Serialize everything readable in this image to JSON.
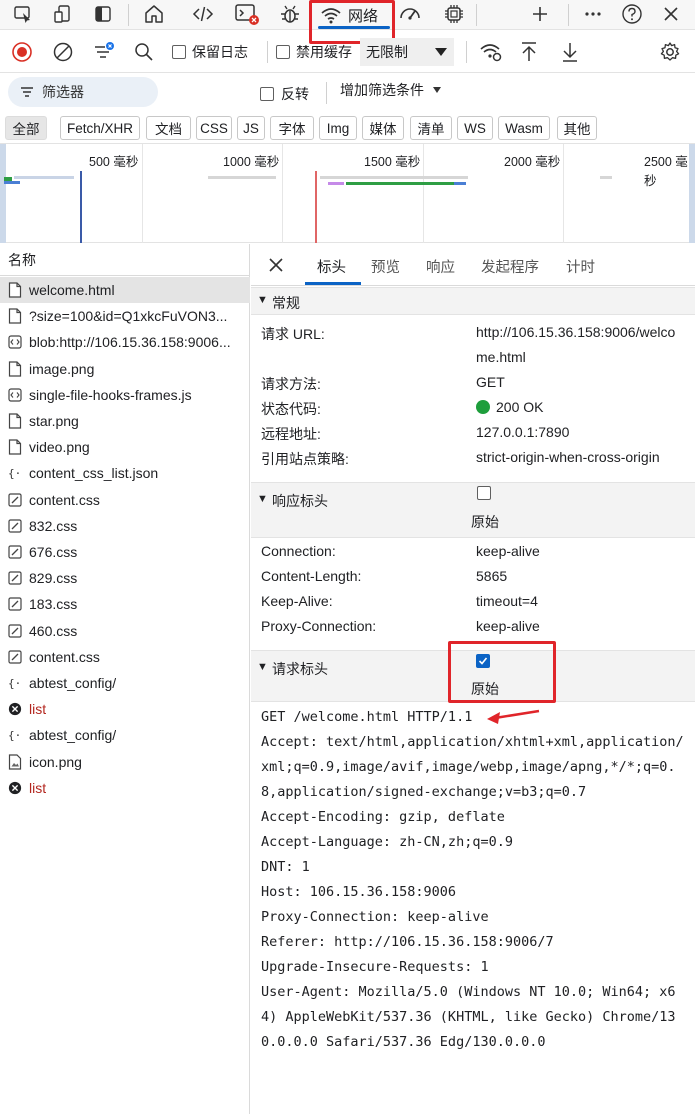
{
  "top_tabs": {
    "network_label": "网络",
    "icons": [
      "inspect-icon",
      "device-icon",
      "sidebar-toggle-icon",
      "home-icon",
      "elements-icon",
      "console-icon",
      "debug-icon",
      "network-icon",
      "performance-icon",
      "memory-icon",
      "add-icon",
      "more-icon",
      "help-icon",
      "close-icon"
    ]
  },
  "toolbar": {
    "preserve_log": "保留日志",
    "disable_cache": "禁用缓存",
    "throttle": "无限制"
  },
  "filter": {
    "placeholder": "筛选器",
    "invert": "反转",
    "add_filter": "增加筛选条件"
  },
  "types": [
    "全部",
    "Fetch/XHR",
    "文档",
    "CSS",
    "JS",
    "字体",
    "Img",
    "媒体",
    "清单",
    "WS",
    "Wasm",
    "其他"
  ],
  "overview": {
    "ticks": [
      "500 毫秒",
      "1000 毫秒",
      "1500 毫秒",
      "2000 毫秒",
      "2500 毫秒"
    ]
  },
  "list": {
    "header": "名称",
    "rows": [
      {
        "name": "welcome.html",
        "kind": "doc",
        "error": false,
        "selected": true
      },
      {
        "name": "?size=100&id=Q1xkcFuVON3...",
        "kind": "doc",
        "error": false
      },
      {
        "name": "blob:http://106.15.36.158:9006...",
        "kind": "script",
        "error": false
      },
      {
        "name": "image.png",
        "kind": "doc",
        "error": false
      },
      {
        "name": "single-file-hooks-frames.js",
        "kind": "script",
        "error": false
      },
      {
        "name": "star.png",
        "kind": "doc",
        "error": false
      },
      {
        "name": "video.png",
        "kind": "doc",
        "error": false
      },
      {
        "name": "content_css_list.json",
        "kind": "json",
        "error": false
      },
      {
        "name": "content.css",
        "kind": "css",
        "error": false
      },
      {
        "name": "832.css",
        "kind": "css",
        "error": false
      },
      {
        "name": "676.css",
        "kind": "css",
        "error": false
      },
      {
        "name": "829.css",
        "kind": "css",
        "error": false
      },
      {
        "name": "183.css",
        "kind": "css",
        "error": false
      },
      {
        "name": "460.css",
        "kind": "css",
        "error": false
      },
      {
        "name": "content.css",
        "kind": "css",
        "error": false
      },
      {
        "name": "abtest_config/",
        "kind": "json",
        "error": false
      },
      {
        "name": "list",
        "kind": "error",
        "error": true
      },
      {
        "name": "abtest_config/",
        "kind": "json",
        "error": false
      },
      {
        "name": "icon.png",
        "kind": "image",
        "error": false
      },
      {
        "name": "list",
        "kind": "error",
        "error": true
      }
    ]
  },
  "detail": {
    "tabs": [
      "标头",
      "预览",
      "响应",
      "发起程序",
      "计时"
    ],
    "general": {
      "title": "常规",
      "url_label": "请求 URL:",
      "url_line1": "http://106.15.36.158:9006/welco",
      "url_line2": "me.html",
      "method_label": "请求方法:",
      "method": "GET",
      "status_label": "状态代码:",
      "status": "200 OK",
      "status_color": "#1e9e3c",
      "remote_label": "远程地址:",
      "remote": "127.0.0.1:7890",
      "policy_label": "引用站点策略:",
      "policy": "strict-origin-when-cross-origin"
    },
    "response_headers": {
      "title": "响应标头",
      "raw_label": "原始",
      "raw_checked": false,
      "items": [
        {
          "k": "Connection:",
          "v": "keep-alive"
        },
        {
          "k": "Content-Length:",
          "v": "5865"
        },
        {
          "k": "Keep-Alive:",
          "v": "timeout=4"
        },
        {
          "k": "Proxy-Connection:",
          "v": "keep-alive"
        }
      ]
    },
    "request_headers": {
      "title": "请求标头",
      "raw_label": "原始",
      "raw_checked": true,
      "raw_lines": [
        "GET /welcome.html HTTP/1.1",
        "Accept: text/html,application/xhtml+xml,application/",
        "xml;q=0.9,image/avif,image/webp,image/apng,*/*;q=0.",
        "8,application/signed-exchange;v=b3;q=0.7",
        "Accept-Encoding: gzip, deflate",
        "Accept-Language: zh-CN,zh;q=0.9",
        "DNT: 1",
        "Host: 106.15.36.158:9006",
        "Proxy-Connection: keep-alive",
        "Referer: http://106.15.36.158:9006/7",
        "Upgrade-Insecure-Requests: 1",
        "User-Agent: Mozilla/5.0 (Windows NT 10.0; Win64; x6",
        "4) AppleWebKit/537.36 (KHTML, like Gecko) Chrome/13",
        "0.0.0.0 Safari/537.36 Edg/130.0.0.0"
      ]
    }
  },
  "colors": {
    "accent": "#0b63c5",
    "highlight_red": "#e0252a",
    "error_text": "#b3261e"
  }
}
